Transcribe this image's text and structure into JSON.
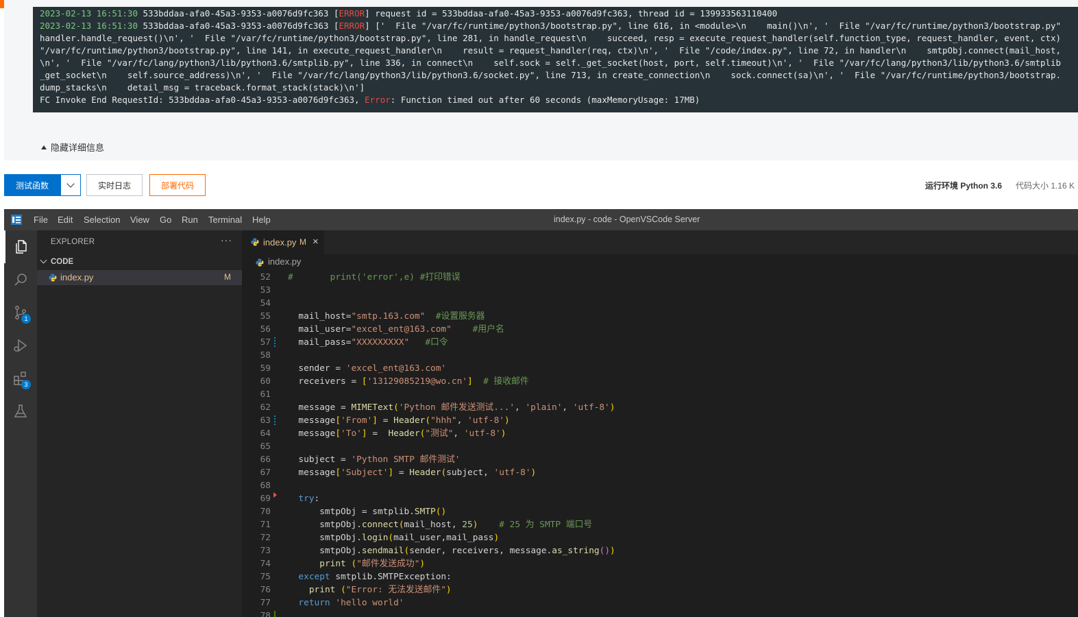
{
  "log": {
    "lines": [
      {
        "ts": "2023-02-13 16:51:30",
        "pre": " 533bddaa-afa0-45a3-9353-a0076d9fc363 [",
        "level": "ERROR",
        "post": "] request id = 533bddaa-afa0-45a3-9353-a0076d9fc363, thread id = 139933563110400"
      },
      {
        "ts": "2023-02-13 16:51:30",
        "pre": " 533bddaa-afa0-45a3-9353-a0076d9fc363 [",
        "level": "ERROR",
        "post": "] ['  File \"/var/fc/runtime/python3/bootstrap.py\", line 616, in <module>\\n    main()\\n', '  File \"/var/fc/runtime/python3/bootstrap.py\""
      },
      {
        "text": "handler.handle_request()\\n', '  File \"/var/fc/runtime/python3/bootstrap.py\", line 281, in handle_request\\n    succeed, resp = execute_request_handler(self.function_type, request_handler, event, ctx)"
      },
      {
        "text": "\"/var/fc/runtime/python3/bootstrap.py\", line 141, in execute_request_handler\\n    result = request_handler(req, ctx)\\n', '  File \"/code/index.py\", line 72, in handler\\n    smtpObj.connect(mail_host,"
      },
      {
        "text": "\\n', '  File \"/var/fc/lang/python3/lib/python3.6/smtplib.py\", line 336, in connect\\n    self.sock = self._get_socket(host, port, self.timeout)\\n', '  File \"/var/fc/lang/python3/lib/python3.6/smtplib"
      },
      {
        "text": "_get_socket\\n    self.source_address)\\n', '  File \"/var/fc/lang/python3/lib/python3.6/socket.py\", line 713, in create_connection\\n    sock.connect(sa)\\n', '  File \"/var/fc/runtime/python3/bootstrap."
      },
      {
        "text": "dump_stacks\\n    detail_msg = traceback.format_stack(stack)\\n']"
      },
      {
        "pre": "FC Invoke End RequestId: 533bddaa-afa0-45a3-9353-a0076d9fc363, ",
        "level": "Error",
        "post": ": Function timed out after 60 seconds (maxMemoryUsage: 17MB)"
      }
    ],
    "hide_detail_label": "隐藏详细信息"
  },
  "toolbar": {
    "test_label": "测试函数",
    "realtime_log_label": "实时日志",
    "deploy_label": "部署代码",
    "runtime_label": "运行环境 Python 3.6",
    "code_size_label": "代码大小 1.16 K"
  },
  "vscode": {
    "menu": [
      "File",
      "Edit",
      "Selection",
      "View",
      "Go",
      "Run",
      "Terminal",
      "Help"
    ],
    "window_title": "index.py - code - OpenVSCode Server",
    "activity_badges": {
      "scm": "1",
      "extensions": "3"
    },
    "explorer": {
      "title": "EXPLORER",
      "more": "···",
      "folder": "CODE",
      "file": {
        "name": "index.py",
        "status": "M"
      }
    },
    "tab": {
      "name": "index.py",
      "status": "M",
      "close": "×"
    },
    "breadcrumb": "index.py",
    "code_lines": [
      {
        "n": "52",
        "g": "",
        "segs": [
          [
            "com",
            "#       print('error',e) #打印错误"
          ]
        ]
      },
      {
        "n": "53",
        "g": "",
        "segs": []
      },
      {
        "n": "54",
        "g": "",
        "segs": []
      },
      {
        "n": "55",
        "g": "",
        "segs": [
          [
            "",
            "  mail_host="
          ],
          [
            "str",
            "\"smtp.163.com\""
          ],
          [
            "",
            "  "
          ],
          [
            "com",
            "#设置服务器"
          ]
        ]
      },
      {
        "n": "56",
        "g": "",
        "segs": [
          [
            "",
            "  mail_user="
          ],
          [
            "str",
            "\"excel_ent@163.com\""
          ],
          [
            "",
            "    "
          ],
          [
            "com",
            "#用户名"
          ]
        ]
      },
      {
        "n": "57",
        "g": "mod",
        "segs": [
          [
            "",
            "  mail_pass="
          ],
          [
            "str",
            "\"XXXXXXXXX\""
          ],
          [
            "",
            "   "
          ],
          [
            "com",
            "#口令"
          ]
        ]
      },
      {
        "n": "58",
        "g": "",
        "segs": []
      },
      {
        "n": "59",
        "g": "",
        "segs": [
          [
            "",
            "  sender = "
          ],
          [
            "str",
            "'excel_ent@163.com'"
          ]
        ]
      },
      {
        "n": "60",
        "g": "",
        "segs": [
          [
            "",
            "  receivers = "
          ],
          [
            "br1",
            "["
          ],
          [
            "str",
            "'13129085219@wo.cn'"
          ],
          [
            "br1",
            "]"
          ],
          [
            "",
            "  "
          ],
          [
            "com",
            "# 接收邮件"
          ]
        ]
      },
      {
        "n": "61",
        "g": "",
        "segs": []
      },
      {
        "n": "62",
        "g": "",
        "segs": [
          [
            "",
            "  message = "
          ],
          [
            "fn",
            "MIMEText"
          ],
          [
            "br1",
            "("
          ],
          [
            "str",
            "'Python 邮件发送测试...'"
          ],
          [
            "",
            ", "
          ],
          [
            "str",
            "'plain'"
          ],
          [
            "",
            ", "
          ],
          [
            "str",
            "'utf-8'"
          ],
          [
            "br1",
            ")"
          ]
        ]
      },
      {
        "n": "63",
        "g": "mod",
        "segs": [
          [
            "",
            "  message"
          ],
          [
            "br1",
            "["
          ],
          [
            "str",
            "'From'"
          ],
          [
            "br1",
            "]"
          ],
          [
            "",
            " = "
          ],
          [
            "fn",
            "Header"
          ],
          [
            "br1",
            "("
          ],
          [
            "str",
            "\"hhh\""
          ],
          [
            "",
            ", "
          ],
          [
            "str",
            "'utf-8'"
          ],
          [
            "br1",
            ")"
          ]
        ]
      },
      {
        "n": "64",
        "g": "",
        "segs": [
          [
            "",
            "  message"
          ],
          [
            "br1",
            "["
          ],
          [
            "str",
            "'To'"
          ],
          [
            "br1",
            "]"
          ],
          [
            "",
            " =  "
          ],
          [
            "fn",
            "Header"
          ],
          [
            "br1",
            "("
          ],
          [
            "str",
            "\"测试\""
          ],
          [
            "",
            ", "
          ],
          [
            "str",
            "'utf-8'"
          ],
          [
            "br1",
            ")"
          ]
        ]
      },
      {
        "n": "65",
        "g": "",
        "segs": []
      },
      {
        "n": "66",
        "g": "",
        "segs": [
          [
            "",
            "  subject = "
          ],
          [
            "str",
            "'Python SMTP 邮件测试'"
          ]
        ]
      },
      {
        "n": "67",
        "g": "",
        "segs": [
          [
            "",
            "  message"
          ],
          [
            "br1",
            "["
          ],
          [
            "str",
            "'Subject'"
          ],
          [
            "br1",
            "]"
          ],
          [
            "",
            " = "
          ],
          [
            "fn",
            "Header"
          ],
          [
            "br1",
            "("
          ],
          [
            "",
            "subject, "
          ],
          [
            "str",
            "'utf-8'"
          ],
          [
            "br1",
            ")"
          ]
        ]
      },
      {
        "n": "68",
        "g": "",
        "segs": []
      },
      {
        "n": "69",
        "g": "del",
        "segs": [
          [
            "kw",
            "  try"
          ],
          [
            "",
            ":"
          ]
        ]
      },
      {
        "n": "70",
        "g": "",
        "segs": [
          [
            "",
            "      smtpObj = smtplib."
          ],
          [
            "fn",
            "SMTP"
          ],
          [
            "br1",
            "()"
          ]
        ]
      },
      {
        "n": "71",
        "g": "",
        "segs": [
          [
            "",
            "      smtpObj."
          ],
          [
            "fn",
            "connect"
          ],
          [
            "br1",
            "("
          ],
          [
            "",
            "mail_host, "
          ],
          [
            "num",
            "25"
          ],
          [
            "br1",
            ")"
          ],
          [
            "",
            "    "
          ],
          [
            "com",
            "# 25 为 SMTP 端口号"
          ]
        ]
      },
      {
        "n": "72",
        "g": "",
        "segs": [
          [
            "",
            "      smtpObj."
          ],
          [
            "fn",
            "login"
          ],
          [
            "br1",
            "("
          ],
          [
            "",
            "mail_user,mail_pass"
          ],
          [
            "br1",
            ")"
          ]
        ]
      },
      {
        "n": "73",
        "g": "",
        "segs": [
          [
            "",
            "      smtpObj."
          ],
          [
            "fn",
            "sendmail"
          ],
          [
            "br1",
            "("
          ],
          [
            "",
            "sender, receivers, message."
          ],
          [
            "fn",
            "as_string"
          ],
          [
            "br2",
            "()"
          ],
          [
            "br1",
            ")"
          ]
        ]
      },
      {
        "n": "74",
        "g": "",
        "segs": [
          [
            "",
            "      "
          ],
          [
            "fn",
            "print"
          ],
          [
            "",
            " "
          ],
          [
            "br1",
            "("
          ],
          [
            "str",
            "\"邮件发送成功\""
          ],
          [
            "br1",
            ")"
          ]
        ]
      },
      {
        "n": "75",
        "g": "",
        "segs": [
          [
            "kw",
            "  except"
          ],
          [
            "",
            " smtplib.SMTPException:"
          ]
        ]
      },
      {
        "n": "76",
        "g": "",
        "segs": [
          [
            "",
            "    "
          ],
          [
            "fn",
            "print"
          ],
          [
            "",
            " "
          ],
          [
            "br1",
            "("
          ],
          [
            "str",
            "\"Error: 无法发送邮件\""
          ],
          [
            "br1",
            ")"
          ]
        ]
      },
      {
        "n": "77",
        "g": "",
        "segs": [
          [
            "kw",
            "  return"
          ],
          [
            "",
            " "
          ],
          [
            "str",
            "'hello world'"
          ]
        ]
      },
      {
        "n": "78",
        "g": "add",
        "segs": []
      }
    ]
  }
}
